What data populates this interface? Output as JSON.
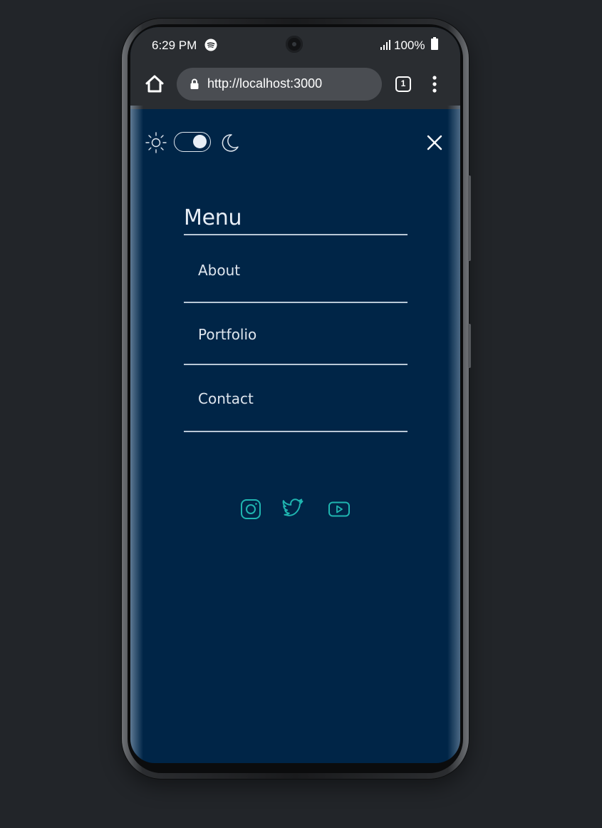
{
  "status_bar": {
    "time": "6:29 PM",
    "battery": "100%"
  },
  "browser": {
    "url": "http://localhost:3000",
    "tab_count": "1"
  },
  "theme_toggle": {
    "mode": "dark"
  },
  "menu": {
    "title": "Menu",
    "items": [
      {
        "label": "About"
      },
      {
        "label": "Portfolio"
      },
      {
        "label": "Contact"
      }
    ]
  },
  "social": [
    {
      "icon": "instagram-icon"
    },
    {
      "icon": "twitter-icon"
    },
    {
      "icon": "youtube-icon"
    }
  ],
  "colors": {
    "background": "#002547",
    "accent": "#1fb5b0",
    "text": "#e8eef6",
    "page_backdrop": "#222529"
  }
}
